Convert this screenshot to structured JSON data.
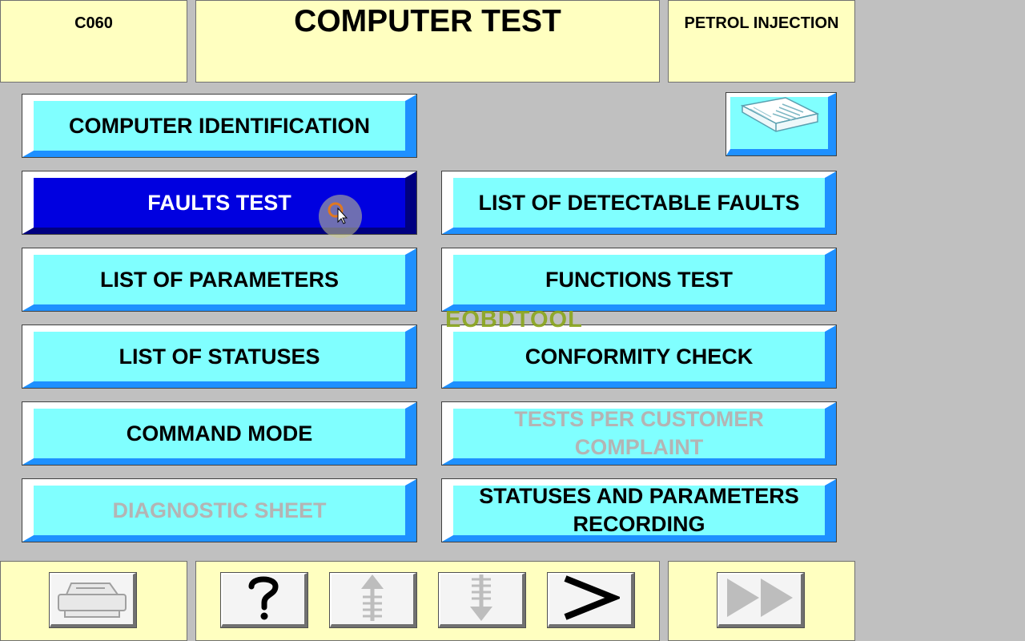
{
  "header": {
    "left_code": "C060",
    "title": "COMPUTER TEST",
    "right_label": "PETROL INJECTION"
  },
  "menu": {
    "computer_identification": "COMPUTER IDENTIFICATION",
    "faults_test": "FAULTS TEST",
    "list_of_detectable_faults": "LIST OF DETECTABLE FAULTS",
    "list_of_parameters": "LIST OF PARAMETERS",
    "functions_test": "FUNCTIONS TEST",
    "list_of_statuses": "LIST OF STATUSES",
    "conformity_check": "CONFORMITY CHECK",
    "command_mode": "COMMAND MODE",
    "tests_per_customer_complaint_line1": "TESTS PER CUSTOMER",
    "tests_per_customer_complaint_line2": "COMPLAINT",
    "diagnostic_sheet": "DIAGNOSTIC SHEET",
    "statuses_and_parameters_recording_line1": "STATUSES AND PARAMETERS",
    "statuses_and_parameters_recording_line2": "RECORDING"
  },
  "watermark": "EOBDTOOL",
  "icons": {
    "manual": "open-book-icon",
    "print": "printer-icon",
    "help": "question-mark-icon",
    "up": "up-arrow-icon",
    "down": "down-arrow-icon",
    "next": "greater-than-icon",
    "forward": "fast-forward-icon"
  },
  "colors": {
    "panel_bg": "#ffffc0",
    "screen_bg": "#c0c0c0",
    "button_bg": "#80ffff",
    "button_active_bg": "#0000e0",
    "button_shadow": "#1e90ff",
    "disabled_text": "#b4b4b4"
  }
}
